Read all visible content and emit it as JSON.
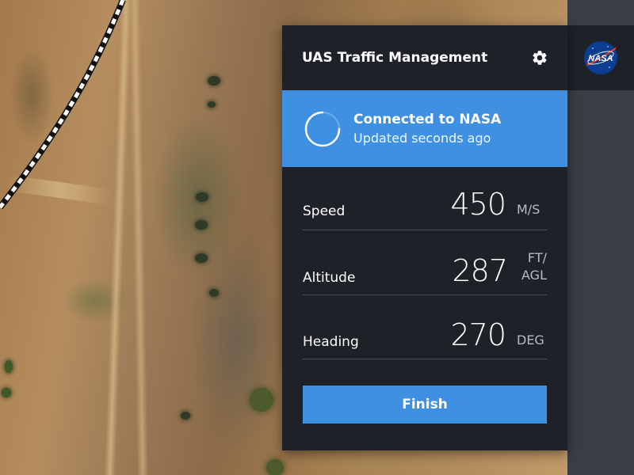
{
  "panel": {
    "title": "UAS Traffic Management"
  },
  "status": {
    "title": "Connected to NASA",
    "subtitle": "Updated seconds ago"
  },
  "metrics": [
    {
      "label": "Speed",
      "value": "450",
      "unit": "M/S"
    },
    {
      "label": "Altitude",
      "value": "287",
      "unit_line1": "FT/",
      "unit_line2": "AGL"
    },
    {
      "label": "Heading",
      "value": "270",
      "unit": "DEG"
    }
  ],
  "actions": {
    "finish_label": "Finish"
  },
  "colors": {
    "accent": "#3f90e1",
    "panel_bg": "#1f2129",
    "sidebar_bg": "#3a3d47"
  },
  "icons": {
    "settings": "gear-icon",
    "status": "spinner-icon",
    "brand": "nasa-logo"
  }
}
